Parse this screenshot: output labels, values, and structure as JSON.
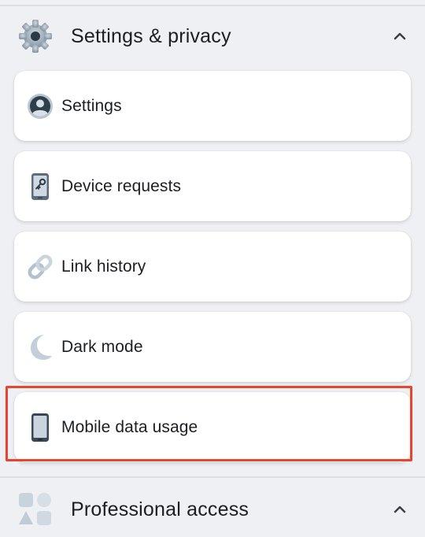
{
  "settings_section": {
    "title": "Settings & privacy",
    "icon": "gear-icon",
    "expanded": true
  },
  "menu_items": [
    {
      "label": "Settings",
      "icon": "profile-circle-icon"
    },
    {
      "label": "Device requests",
      "icon": "phone-key-icon"
    },
    {
      "label": "Link history",
      "icon": "link-chain-icon"
    },
    {
      "label": "Dark mode",
      "icon": "moon-icon"
    },
    {
      "label": "Mobile data usage",
      "icon": "mobile-phone-icon"
    }
  ],
  "professional_section": {
    "title": "Professional access",
    "icon": "shapes-grid-icon",
    "expanded": true
  },
  "highlight_color": "#e8452c"
}
